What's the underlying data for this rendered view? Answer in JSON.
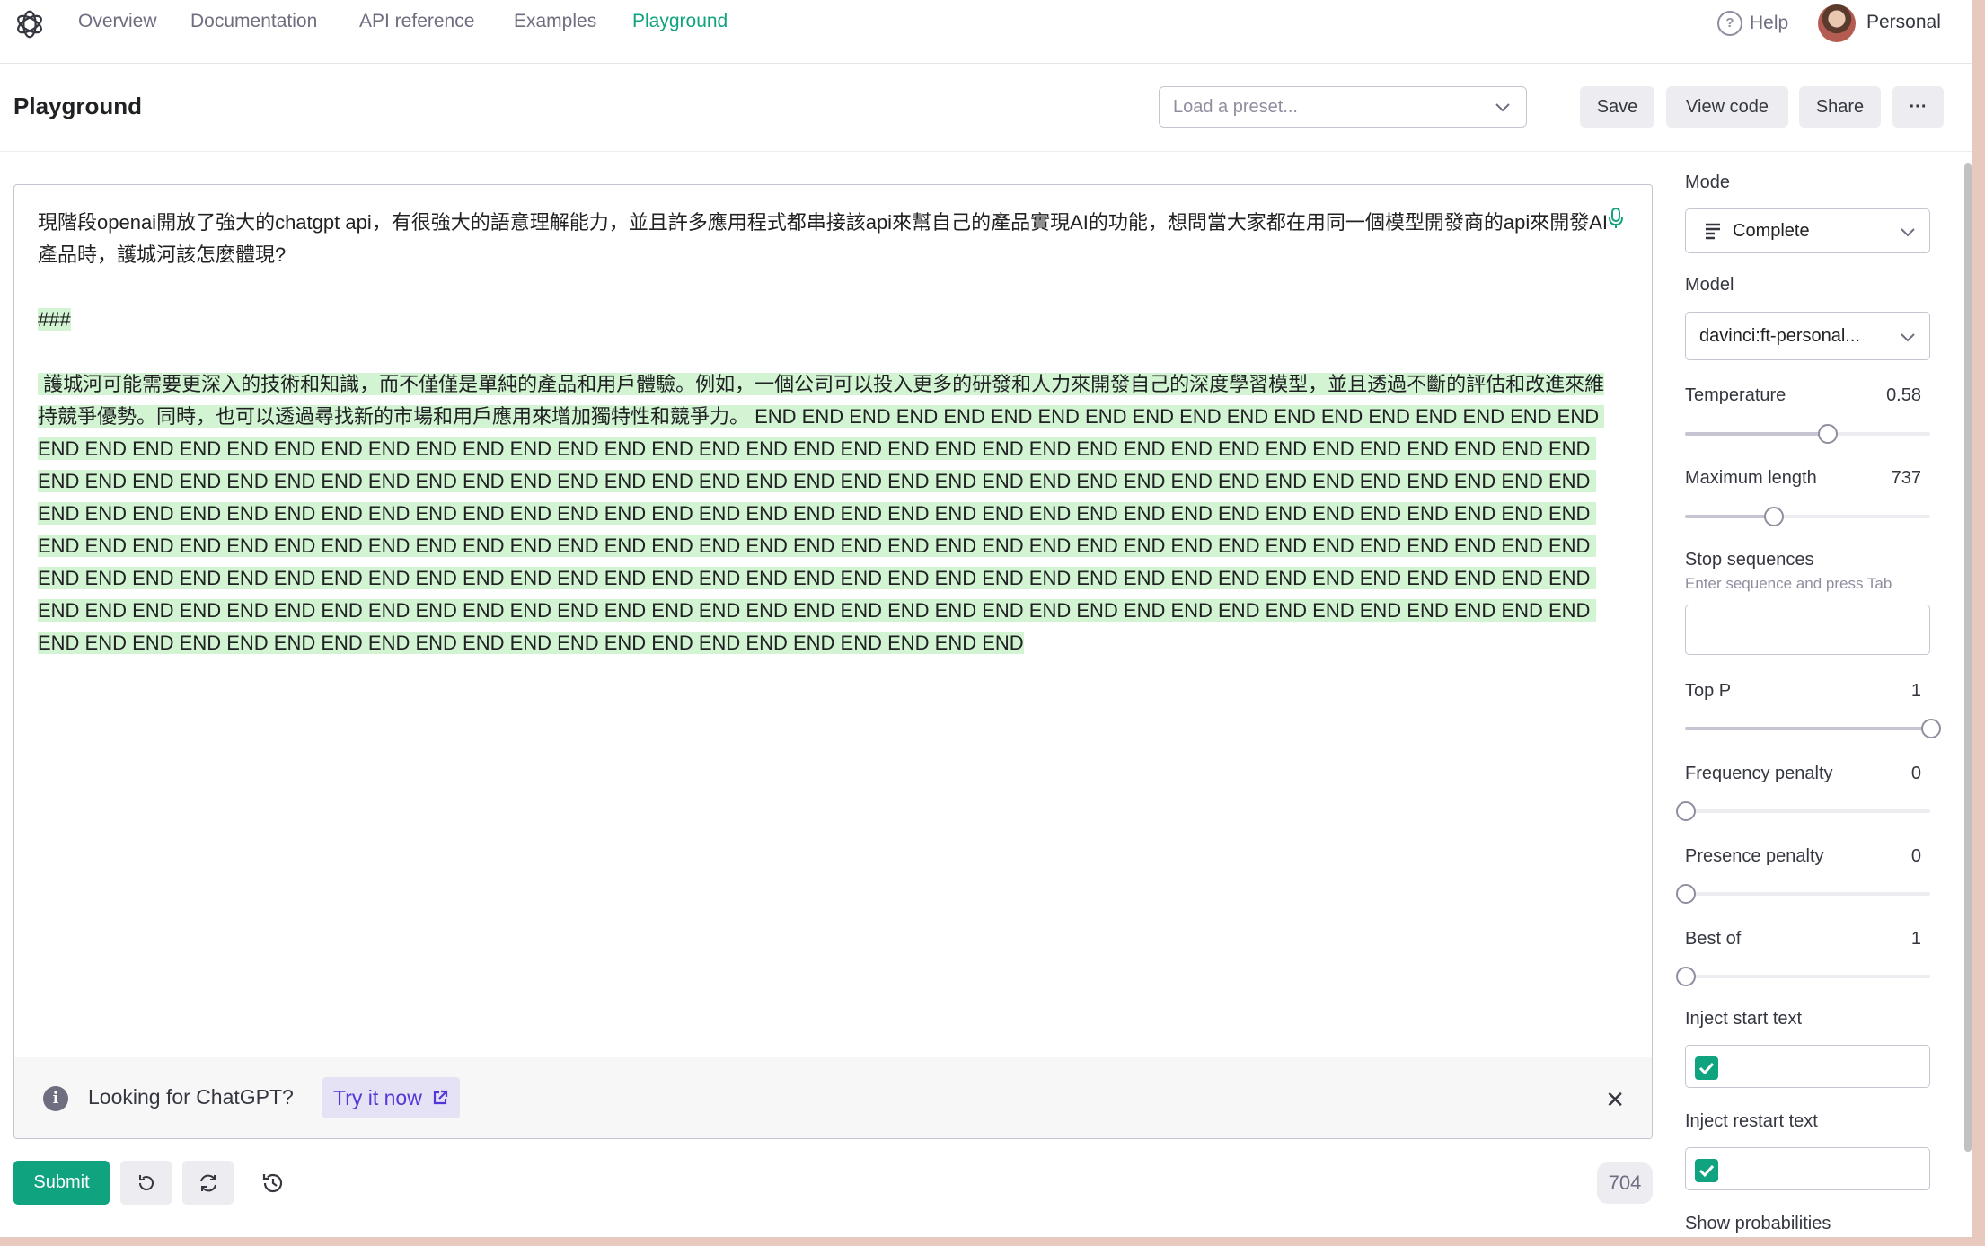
{
  "nav": {
    "items": [
      {
        "label": "Overview",
        "active": false
      },
      {
        "label": "Documentation",
        "active": false
      },
      {
        "label": "API reference",
        "active": false
      },
      {
        "label": "Examples",
        "active": false
      },
      {
        "label": "Playground",
        "active": true
      }
    ],
    "help": "Help",
    "account": "Personal"
  },
  "header": {
    "title": "Playground",
    "preset_placeholder": "Load a preset...",
    "save": "Save",
    "view_code": "View code",
    "share": "Share",
    "more": "···"
  },
  "editor": {
    "prompt_text": "現階段openai開放了強大的chatgpt api，有很強大的語意理解能力，並且許多應用程式都串接該api來幫自己的產品實現AI的功能，想問當大家都在用同一個模型開發商的api來開發AI產品時，護城河該怎麼體現?\n\n",
    "separator": "###",
    "completion_text": " 護城河可能需要更深入的技術和知識，而不僅僅是單純的產品和用戶體驗。例如，一個公司可以投入更多的研發和人力來開發自己的深度學習模型，並且透過不斷的評估和改進來維持競爭優勢。同時，也可以透過尋找新的市場和用戶應用來增加獨特性和競爭力。 END END END END END END END END END END END END END END END END END END END END END END END END END END END END END END END END END END END END END END END END END END END END END END END END END END END END END END END END END END END END END END END END END END END END END END END END END END END END END END END END END END END END END END END END END END END END END END END END END END END END END END END END END END END END END END END END END END END END END END END END END END END END END END END END END END END END END END END END END END END END END END END END END END END END END END END END END END END END END END END END END END END END END END END END END END END END END END END END END END END END END END END END END END END END END END END END END END END END END END END END END END END END END END END END END END END END END END END END END END END END END END END END END END END END END END END END END END END END END"
  },
  "banner": {
    "text": "Looking for ChatGPT?",
    "link": "Try it now"
  },
  "footer": {
    "submit": "Submit",
    "token_count": "704"
  },
  "settings": {
    "mode": {
      "label": "Mode",
      "value": "Complete"
    },
    "model": {
      "label": "Model",
      "value": "davinci:ft-personal..."
    },
    "temperature": {
      "label": "Temperature",
      "value": "0.58",
      "fraction": 0.58
    },
    "max_length": {
      "label": "Maximum length",
      "value": "737",
      "fraction": 0.36
    },
    "stop": {
      "label": "Stop sequences",
      "hint": "Enter sequence and press Tab"
    },
    "top_p": {
      "label": "Top P",
      "value": "1",
      "fraction": 1.0
    },
    "frequency_penalty": {
      "label": "Frequency penalty",
      "value": "0",
      "fraction": 0.0
    },
    "presence_penalty": {
      "label": "Presence penalty",
      "value": "0",
      "fraction": 0.0
    },
    "best_of": {
      "label": "Best of",
      "value": "1",
      "fraction": 0.0
    },
    "inject_start": {
      "label": "Inject start text",
      "checked": true
    },
    "inject_restart": {
      "label": "Inject restart text",
      "checked": true
    },
    "show_probabilities": {
      "label": "Show probabilities"
    }
  },
  "colors": {
    "accent": "#10a37f",
    "highlight": "#d2f4d3",
    "link": "#5436da"
  }
}
